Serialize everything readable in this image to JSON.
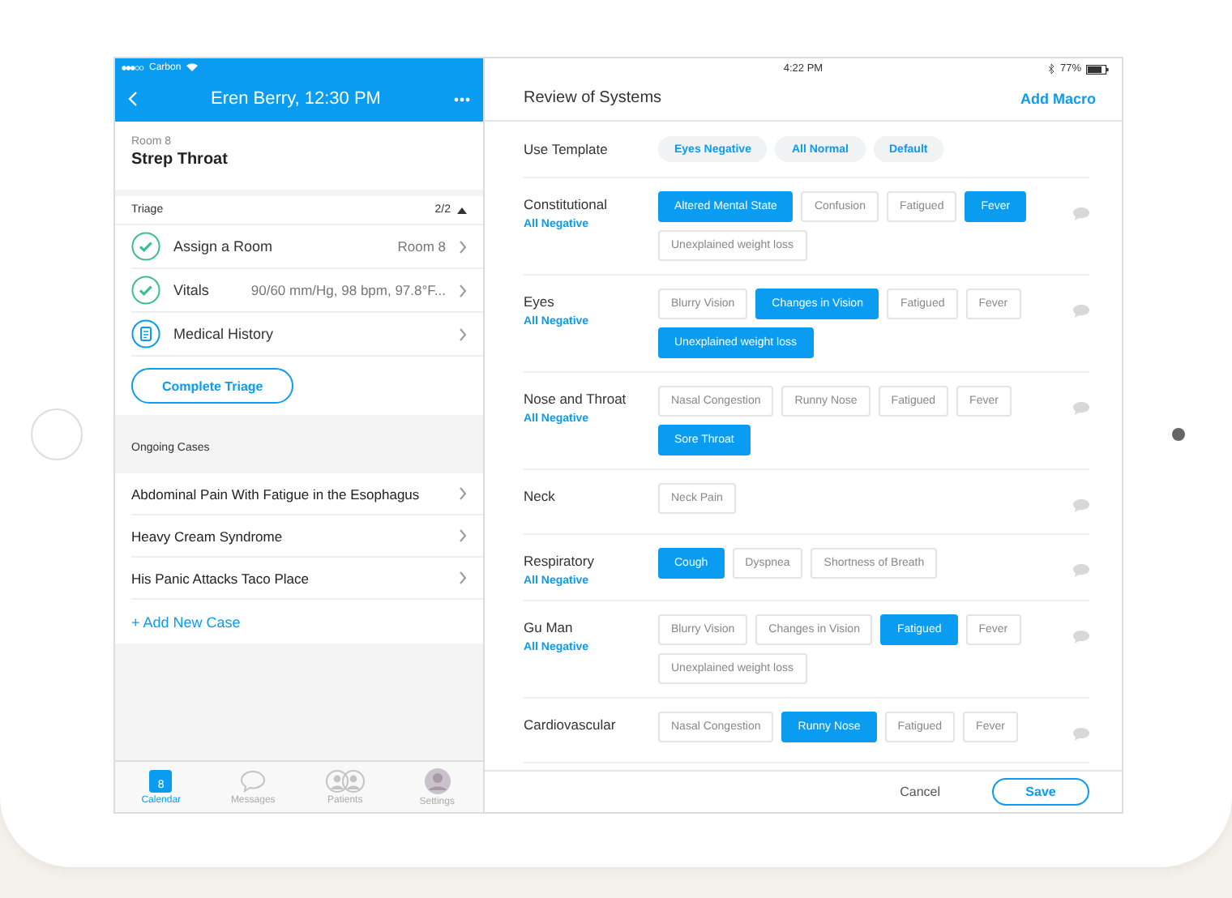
{
  "left": {
    "status": {
      "carrier": "Carbon"
    },
    "header": {
      "title": "Eren Berry, 12:30 PM"
    },
    "room": "Room 8",
    "case": "Strep Throat",
    "triage": {
      "label": "Triage",
      "count": "2/2",
      "expanded": true,
      "items": [
        {
          "kind": "check",
          "label": "Assign a Room",
          "value": "Room 8"
        },
        {
          "kind": "check",
          "label": "Vitals",
          "value": "90/60 mm/Hg, 98 bpm, 97.8°F..."
        },
        {
          "kind": "clipboard",
          "label": "Medical History"
        }
      ]
    },
    "complete_button": "Complete Triage",
    "ongoing": {
      "label": "Ongoing Cases",
      "cases": [
        "Abdominal Pain With Fatigue in the Esophagus",
        "Heavy Cream Syndrome",
        "His Panic Attacks Taco Place"
      ],
      "add": "+ Add New Case"
    },
    "tabbar": [
      {
        "kind": "calendar",
        "label": "Calendar",
        "badge": "8",
        "selected": true
      },
      {
        "kind": "messages",
        "label": "Messages",
        "selected": false
      },
      {
        "kind": "patients",
        "label": "Patients",
        "selected": false
      },
      {
        "kind": "avatar",
        "label": "Settings",
        "selected": false
      }
    ]
  },
  "right": {
    "status": {
      "time": "4:22 PM",
      "battery": "77%"
    },
    "title": "Review of Systems",
    "action": "Add Macro",
    "template": {
      "label": "Use Template",
      "options": [
        "Eyes Negative",
        "All Normal",
        "Default"
      ]
    },
    "systems": [
      {
        "name": "Constitutional",
        "all_negative": "All Negative",
        "findings": [
          {
            "label": "Altered Mental State",
            "selected": true
          },
          {
            "label": "Confusion",
            "selected": false
          },
          {
            "label": "Fatigued",
            "selected": false
          },
          {
            "label": "Fever",
            "selected": true
          },
          {
            "label": "Unexplained weight loss",
            "selected": false
          }
        ]
      },
      {
        "name": "Eyes",
        "all_negative": "All Negative",
        "findings": [
          {
            "label": "Blurry Vision",
            "selected": false
          },
          {
            "label": "Changes in Vision",
            "selected": true
          },
          {
            "label": "Fatigued",
            "selected": false
          },
          {
            "label": "Fever",
            "selected": false
          },
          {
            "label": "Unexplained weight loss",
            "selected": true
          }
        ]
      },
      {
        "name": "Nose and Throat",
        "all_negative": "All Negative",
        "findings": [
          {
            "label": "Nasal Congestion",
            "selected": false
          },
          {
            "label": "Runny Nose",
            "selected": false
          },
          {
            "label": "Fatigued",
            "selected": false
          },
          {
            "label": "Fever",
            "selected": false
          },
          {
            "label": "Sore Throat",
            "selected": true
          }
        ]
      },
      {
        "name": "Neck",
        "findings": [
          {
            "label": "Neck Pain",
            "selected": false
          }
        ]
      },
      {
        "name": "Respiratory",
        "all_negative": "All Negative",
        "findings": [
          {
            "label": "Cough",
            "selected": true
          },
          {
            "label": "Dyspnea",
            "selected": false
          },
          {
            "label": "Shortness of Breath",
            "selected": false
          }
        ]
      },
      {
        "name": "Gu Man",
        "all_negative": "All Negative",
        "findings": [
          {
            "label": "Blurry Vision",
            "selected": false
          },
          {
            "label": "Changes in Vision",
            "selected": false
          },
          {
            "label": "Fatigued",
            "selected": true
          },
          {
            "label": "Fever",
            "selected": false
          },
          {
            "label": "Unexplained weight loss",
            "selected": false
          }
        ]
      },
      {
        "name": "Cardiovascular",
        "findings": [
          {
            "label": "Nasal Congestion",
            "selected": false
          },
          {
            "label": "Runny Nose",
            "selected": true
          },
          {
            "label": "Fatigued",
            "selected": false
          },
          {
            "label": "Fever",
            "selected": false
          }
        ]
      }
    ],
    "footer": {
      "cancel": "Cancel",
      "save": "Save"
    }
  }
}
